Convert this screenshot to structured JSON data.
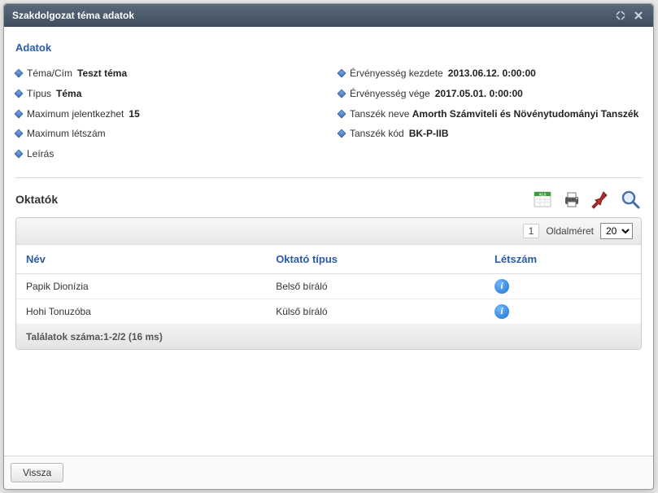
{
  "dialog": {
    "title": "Szakdolgozat téma adatok",
    "section_title": "Adatok",
    "oktatok_title": "Oktatók",
    "back_label": "Vissza"
  },
  "left_fields": [
    {
      "label": "Téma/Cím",
      "value": "Teszt téma"
    },
    {
      "label": "Típus",
      "value": "Téma"
    },
    {
      "label": "Maximum jelentkezhet",
      "value": "15"
    },
    {
      "label": "Maximum létszám",
      "value": ""
    },
    {
      "label": "Leírás",
      "value": ""
    }
  ],
  "right_fields": [
    {
      "label": "Érvényesség kezdete",
      "value": "2013.06.12. 0:00:00"
    },
    {
      "label": "Érvényesség vége",
      "value": "2017.05.01. 0:00:00"
    },
    {
      "label": "Tanszék neve",
      "value": "Amorth Számviteli és Növénytudományi Tanszék"
    },
    {
      "label": "Tanszék kód",
      "value": "BK-P-IIB"
    }
  ],
  "grid": {
    "page_number": "1",
    "page_size_label": "Oldalméret",
    "page_size_value": "20",
    "headers": {
      "name": "Név",
      "type": "Oktató típus",
      "count": "Létszám"
    },
    "rows": [
      {
        "name": "Papik Dionízia",
        "type": "Belső bíráló",
        "count_info": "i"
      },
      {
        "name": "Hohi Tonuzóba",
        "type": "Külső bíráló",
        "count_info": "i"
      }
    ],
    "footer": "Találatok száma:1-2/2 (16 ms)"
  },
  "toolbar": {
    "xls": "XLS",
    "print": "print",
    "pin": "pin",
    "search": "search"
  }
}
